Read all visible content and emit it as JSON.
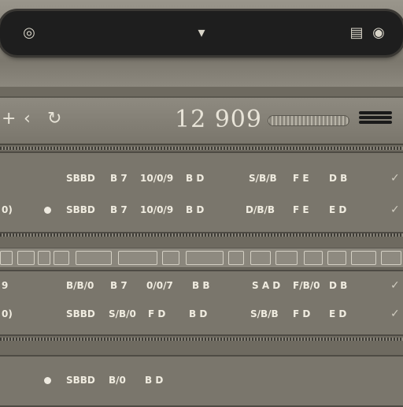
{
  "topbar": {
    "left_icon": "spiral-icon",
    "center_icon": "spinner-icon",
    "right_icons": [
      "window-icon",
      "target-icon"
    ]
  },
  "header": {
    "left_icons": [
      "plus-icon",
      "back-icon",
      "refresh-icon"
    ],
    "readout": "12 909",
    "menu_icon": "hamburger-icon"
  },
  "panel1": {
    "rows": [
      {
        "a": "SBBD",
        "b": "B 7",
        "c": "10/0/9",
        "d": "B D",
        "e": "S/B/B",
        "f": "F E",
        "g": "D B"
      },
      {
        "lead": "0)",
        "a": "SBBD",
        "b": "B 7",
        "c": "10/0/9",
        "d": "B D",
        "e": "D/B/B",
        "f": "F E",
        "g": "E D"
      }
    ]
  },
  "panel2": {
    "rows": [
      {
        "lead": "9",
        "a": "B/B/0",
        "b": "B 7",
        "c": "0/0/7",
        "d": "B B",
        "e": "S A D",
        "f": "F/B/0",
        "g": "D B"
      },
      {
        "lead": "0)",
        "a": "SBBD",
        "b": "S/B/0",
        "c": "F D",
        "d": "B D",
        "e": "S/B/B",
        "f": "F D",
        "g": "E D"
      }
    ]
  },
  "panel3": {
    "rows": [
      {
        "a": "SBBD",
        "b": "B/0",
        "c": "B D"
      }
    ]
  },
  "colors": {
    "background": "#6e6a60",
    "text": "#f0ece0",
    "topbar": "#1e1e1e"
  }
}
